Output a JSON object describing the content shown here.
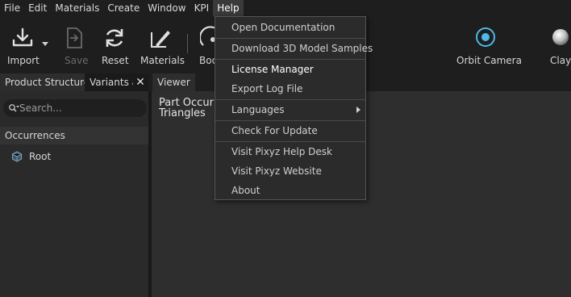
{
  "menubar": {
    "items": [
      "File",
      "Edit",
      "Materials",
      "Create",
      "Window",
      "KPI",
      "Help"
    ]
  },
  "toolbar": {
    "import_label": "Import",
    "save_label": "Save",
    "reset_label": "Reset",
    "materials_label": "Materials",
    "boo_label": "Boo",
    "orbit_label": "Orbit Camera",
    "clay_label": "Clay"
  },
  "left_tabs": {
    "product_structure": "Product Structure",
    "variants": "Variants a"
  },
  "viewer_tab": "Viewer",
  "search": {
    "placeholder": "Search..."
  },
  "occurrences": {
    "header": "Occurrences",
    "root": "Root"
  },
  "viewer": {
    "line1": "Part Occur",
    "line2": "Triangles"
  },
  "help_menu": {
    "items": [
      "Open Documentation",
      "Download 3D Model Samples",
      "License Manager",
      "Export Log File",
      "Languages",
      "Check For Update",
      "Visit Pixyz Help Desk",
      "Visit Pixyz Website",
      "About"
    ]
  },
  "colors": {
    "accent": "#4fb8e8",
    "menu_bg": "#2b2b2b",
    "panel_bg": "#2a2a2a"
  }
}
